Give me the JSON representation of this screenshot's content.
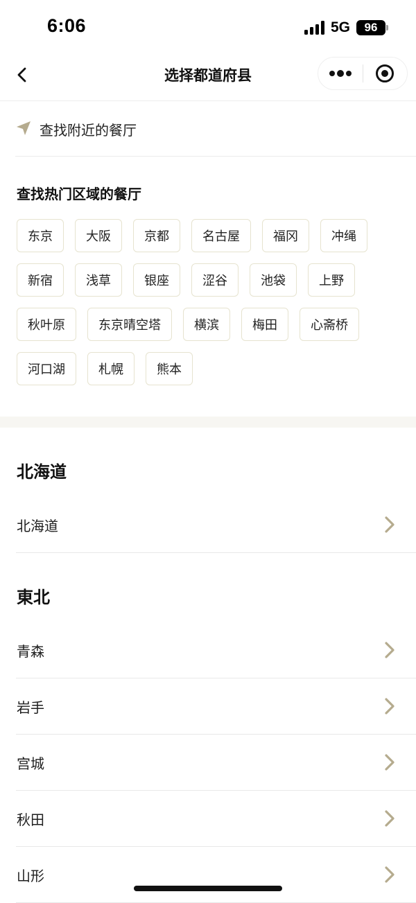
{
  "status_bar": {
    "time": "6:06",
    "network": "5G",
    "battery": "96"
  },
  "nav": {
    "title": "选择都道府县",
    "back_icon": "chevron-left-icon",
    "more_icon": "more-dots-icon",
    "close_icon": "target-circle-icon"
  },
  "nearby": {
    "label": "查找附近的餐厅",
    "icon": "location-arrow-icon",
    "icon_color": "#b5ab8e"
  },
  "hot_areas": {
    "title": "查找热门区域的餐厅",
    "chips": [
      "东京",
      "大阪",
      "京都",
      "名古屋",
      "福冈",
      "冲绳",
      "新宿",
      "浅草",
      "银座",
      "涩谷",
      "池袋",
      "上野",
      "秋叶原",
      "东京晴空塔",
      "横滨",
      "梅田",
      "心斋桥",
      "河口湖",
      "札幌",
      "熊本"
    ]
  },
  "regions": [
    {
      "name": "北海道",
      "items": [
        "北海道"
      ]
    },
    {
      "name": "東北",
      "items": [
        "青森",
        "岩手",
        "宫城",
        "秋田",
        "山形"
      ]
    }
  ],
  "colors": {
    "accent": "#b5ab8e",
    "chip_border": "#e6e3cf",
    "section_gap": "#f7f6f2"
  }
}
